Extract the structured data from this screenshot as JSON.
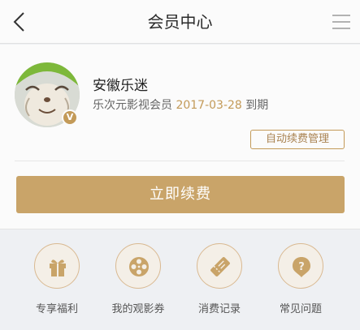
{
  "nav": {
    "title": "会员中心",
    "back_icon": "chevron-left-icon",
    "menu_icon": "hamburger-menu-icon"
  },
  "profile": {
    "username": "安徽乐迷",
    "membership_prefix": "乐次元影视会员",
    "expiry_date": "2017-03-28",
    "expiry_suffix": "到期",
    "vip_badge": "V",
    "auto_renew_label": "自动续费管理"
  },
  "renew_button": "立即续费",
  "services": [
    {
      "label": "专享福利",
      "icon": "gift-icon"
    },
    {
      "label": "我的观影券",
      "icon": "film-reel-icon"
    },
    {
      "label": "消费记录",
      "icon": "ticket-icon"
    },
    {
      "label": "常见问题",
      "icon": "question-icon"
    }
  ],
  "colors": {
    "accent": "#c9a469",
    "accent_text": "#c39a58",
    "background": "#eef0f3",
    "card": "#fbfbfb"
  }
}
